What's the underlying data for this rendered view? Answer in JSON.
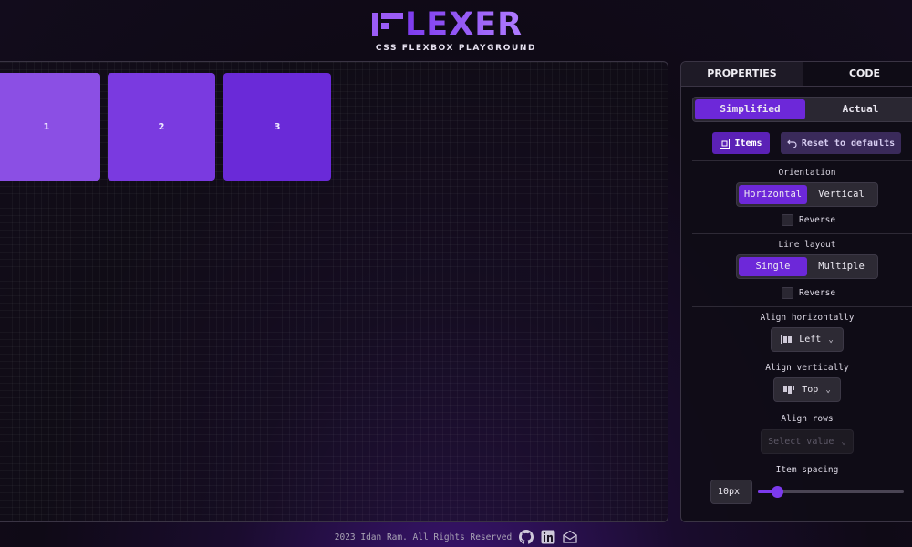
{
  "header": {
    "logo_text": "LEXER",
    "subtitle": "CSS FLEXBOX PLAYGROUND"
  },
  "canvas": {
    "items": [
      {
        "label": "1",
        "color": "#8b4fe4"
      },
      {
        "label": "2",
        "color": "#7a3ae0"
      },
      {
        "label": "3",
        "color": "#6a2ad8"
      }
    ]
  },
  "panel": {
    "tabs": {
      "properties": "PROPERTIES",
      "code": "CODE"
    },
    "mode": {
      "simplified": "Simplified",
      "actual": "Actual"
    },
    "actions": {
      "items": "Items",
      "reset": "Reset to defaults"
    },
    "orientation": {
      "label": "Orientation",
      "options": [
        "Horizontal",
        "Vertical"
      ],
      "selected": "Horizontal",
      "reverse_label": "Reverse",
      "reverse_checked": false
    },
    "line_layout": {
      "label": "Line layout",
      "options": [
        "Single",
        "Multiple"
      ],
      "selected": "Single",
      "reverse_label": "Reverse",
      "reverse_checked": false
    },
    "align_horizontally": {
      "label": "Align horizontally",
      "value": "Left"
    },
    "align_vertically": {
      "label": "Align vertically",
      "value": "Top"
    },
    "align_rows": {
      "label": "Align rows",
      "placeholder": "Select value",
      "disabled": true
    },
    "item_spacing": {
      "label": "Item spacing",
      "value": "10px",
      "slider_fraction": 0.13
    }
  },
  "footer": {
    "copyright": "2023 Idan Ram. All Rights Reserved",
    "icons": [
      "github-icon",
      "linkedin-icon",
      "mail-icon"
    ]
  },
  "colors": {
    "accent": "#6d28d9",
    "accent_light": "#9b5cf6",
    "background": "#0f0a16"
  }
}
